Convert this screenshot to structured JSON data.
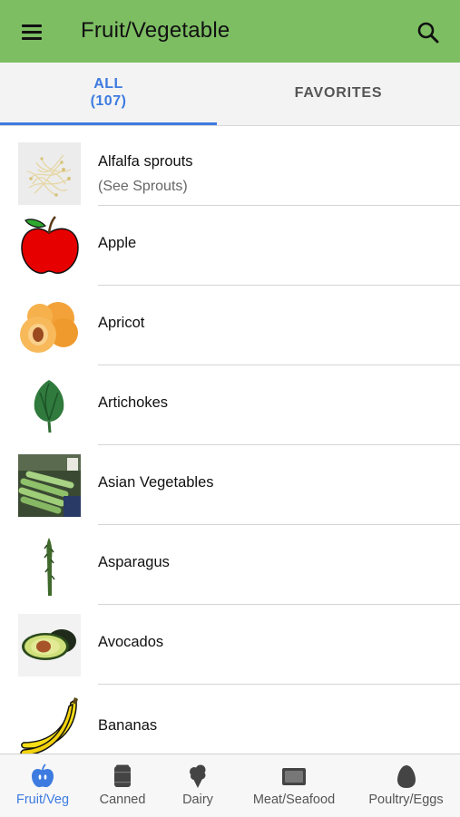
{
  "header": {
    "title": "Fruit/Vegetable",
    "menu_icon": "hamburger-menu-icon",
    "search_icon": "search-icon",
    "brand_color": "#7dbe63"
  },
  "tabs": {
    "all_label": "ALL",
    "all_count": "(107)",
    "favorites_label": "FAVORITES",
    "active_color": "#3d7be0"
  },
  "items": [
    {
      "name": "Alfalfa sprouts",
      "note": "(See Sprouts)",
      "image": "alfalfa-sprouts-image"
    },
    {
      "name": "Apple",
      "image": "apple-image"
    },
    {
      "name": "Apricot",
      "image": "apricot-image"
    },
    {
      "name": "Artichokes",
      "image": "artichoke-image"
    },
    {
      "name": "Asian Vegetables",
      "image": "asian-vegetables-image"
    },
    {
      "name": "Asparagus",
      "image": "asparagus-image"
    },
    {
      "name": "Avocados",
      "image": "avocado-image"
    },
    {
      "name": "Bananas",
      "image": "banana-image"
    }
  ],
  "bottom_nav": [
    {
      "label": "Fruit/Veg",
      "icon": "apple-icon",
      "active": true
    },
    {
      "label": "Canned",
      "icon": "can-icon",
      "active": false
    },
    {
      "label": "Dairy",
      "icon": "ice-cream-icon",
      "active": false
    },
    {
      "label": "Meat/Seafood",
      "icon": "meat-tray-icon",
      "active": false
    },
    {
      "label": "Poultry/Eggs",
      "icon": "egg-icon",
      "active": false
    }
  ]
}
